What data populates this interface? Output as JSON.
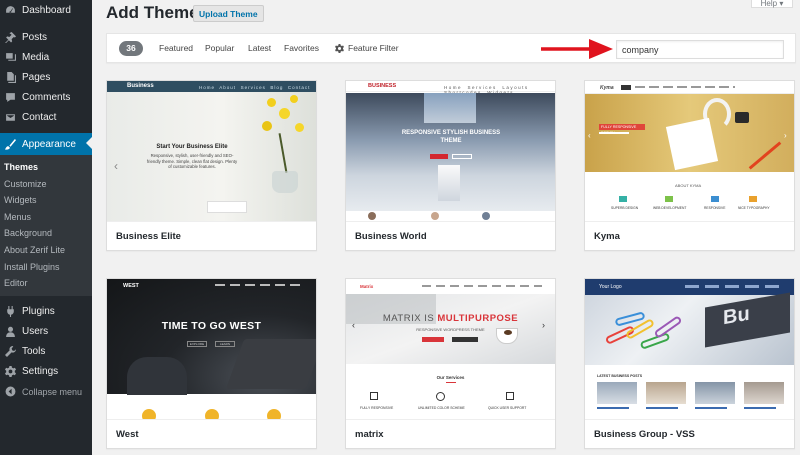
{
  "sidebar": {
    "items_top": [
      {
        "label": "Dashboard",
        "icon": "dashboard-icon"
      },
      {
        "label": "Posts",
        "icon": "pin-icon"
      },
      {
        "label": "Media",
        "icon": "media-icon"
      },
      {
        "label": "Pages",
        "icon": "page-icon"
      },
      {
        "label": "Comments",
        "icon": "comment-icon"
      },
      {
        "label": "Contact",
        "icon": "mail-icon"
      }
    ],
    "active": {
      "label": "Appearance",
      "icon": "paintbrush-icon"
    },
    "submenu": [
      "Themes",
      "Customize",
      "Widgets",
      "Menus",
      "Background",
      "About Zerif Lite",
      "Install Plugins",
      "Editor"
    ],
    "items_bottom": [
      {
        "label": "Plugins",
        "icon": "plug-icon"
      },
      {
        "label": "Users",
        "icon": "user-icon"
      },
      {
        "label": "Tools",
        "icon": "wrench-icon"
      },
      {
        "label": "Settings",
        "icon": "settings-icon"
      }
    ],
    "collapse_label": "Collapse menu"
  },
  "header": {
    "title": "Add Themes",
    "upload_label": "Upload Theme",
    "help_label": "Help"
  },
  "filters": {
    "count": "36",
    "links": [
      "Featured",
      "Popular",
      "Latest",
      "Favorites"
    ],
    "feature_filter_label": "Feature Filter",
    "search_value": "company"
  },
  "themes": [
    {
      "name": "Business Elite",
      "preview": {
        "brand": "Business",
        "headline": "Start Your Business Elite",
        "tagline": "Responsive, stylish, user-friendly and SEO-friendly theme. Simple, clean flat design. Plenty of customizable features.",
        "nav": [
          "Home",
          "About",
          "Services",
          "Blog",
          "Contact"
        ]
      }
    },
    {
      "name": "Business World",
      "preview": {
        "brand": "BUSINESS",
        "headline": "RESPONSIVE STYLISH BUSINESS THEME",
        "nav": [
          "Home",
          "Services",
          "Layouts",
          "Shortcodes",
          "Widgets"
        ]
      }
    },
    {
      "name": "Kyma",
      "preview": {
        "brand": "Kyma",
        "headline": "FULLY RESPONSIVE DESIGN",
        "section": "ABOUT KYMA",
        "features": [
          "SUPERB DESIGN",
          "WEB DEVELOPMENT",
          "RESPONSIVE",
          "NICE TYPOGRAPHY"
        ]
      }
    },
    {
      "name": "West",
      "preview": {
        "brand": "WEST",
        "headline": "TIME TO GO WEST",
        "buttons": [
          "EXPLORE",
          "LEARN"
        ]
      }
    },
    {
      "name": "matrix",
      "preview": {
        "brand": "Matrix",
        "headline_a": "MATRIX IS ",
        "headline_b": "MULTIPURPOSE",
        "sub": "RESPONSIVE WORDPRESS THEME",
        "section": "Our Services",
        "features": [
          "FULLY RESPONSIVE",
          "UNLIMITED COLOR SCHEME",
          "QUICK USER SUPPORT"
        ]
      }
    },
    {
      "name": "Business Group - VSS",
      "preview": {
        "brand": "Your Logo",
        "section": "LATEST BUSINESS POSTS"
      }
    }
  ],
  "colors": {
    "sidebar_bg": "#23282d",
    "active_bg": "#0073aa",
    "arrow": "#e0141e"
  }
}
